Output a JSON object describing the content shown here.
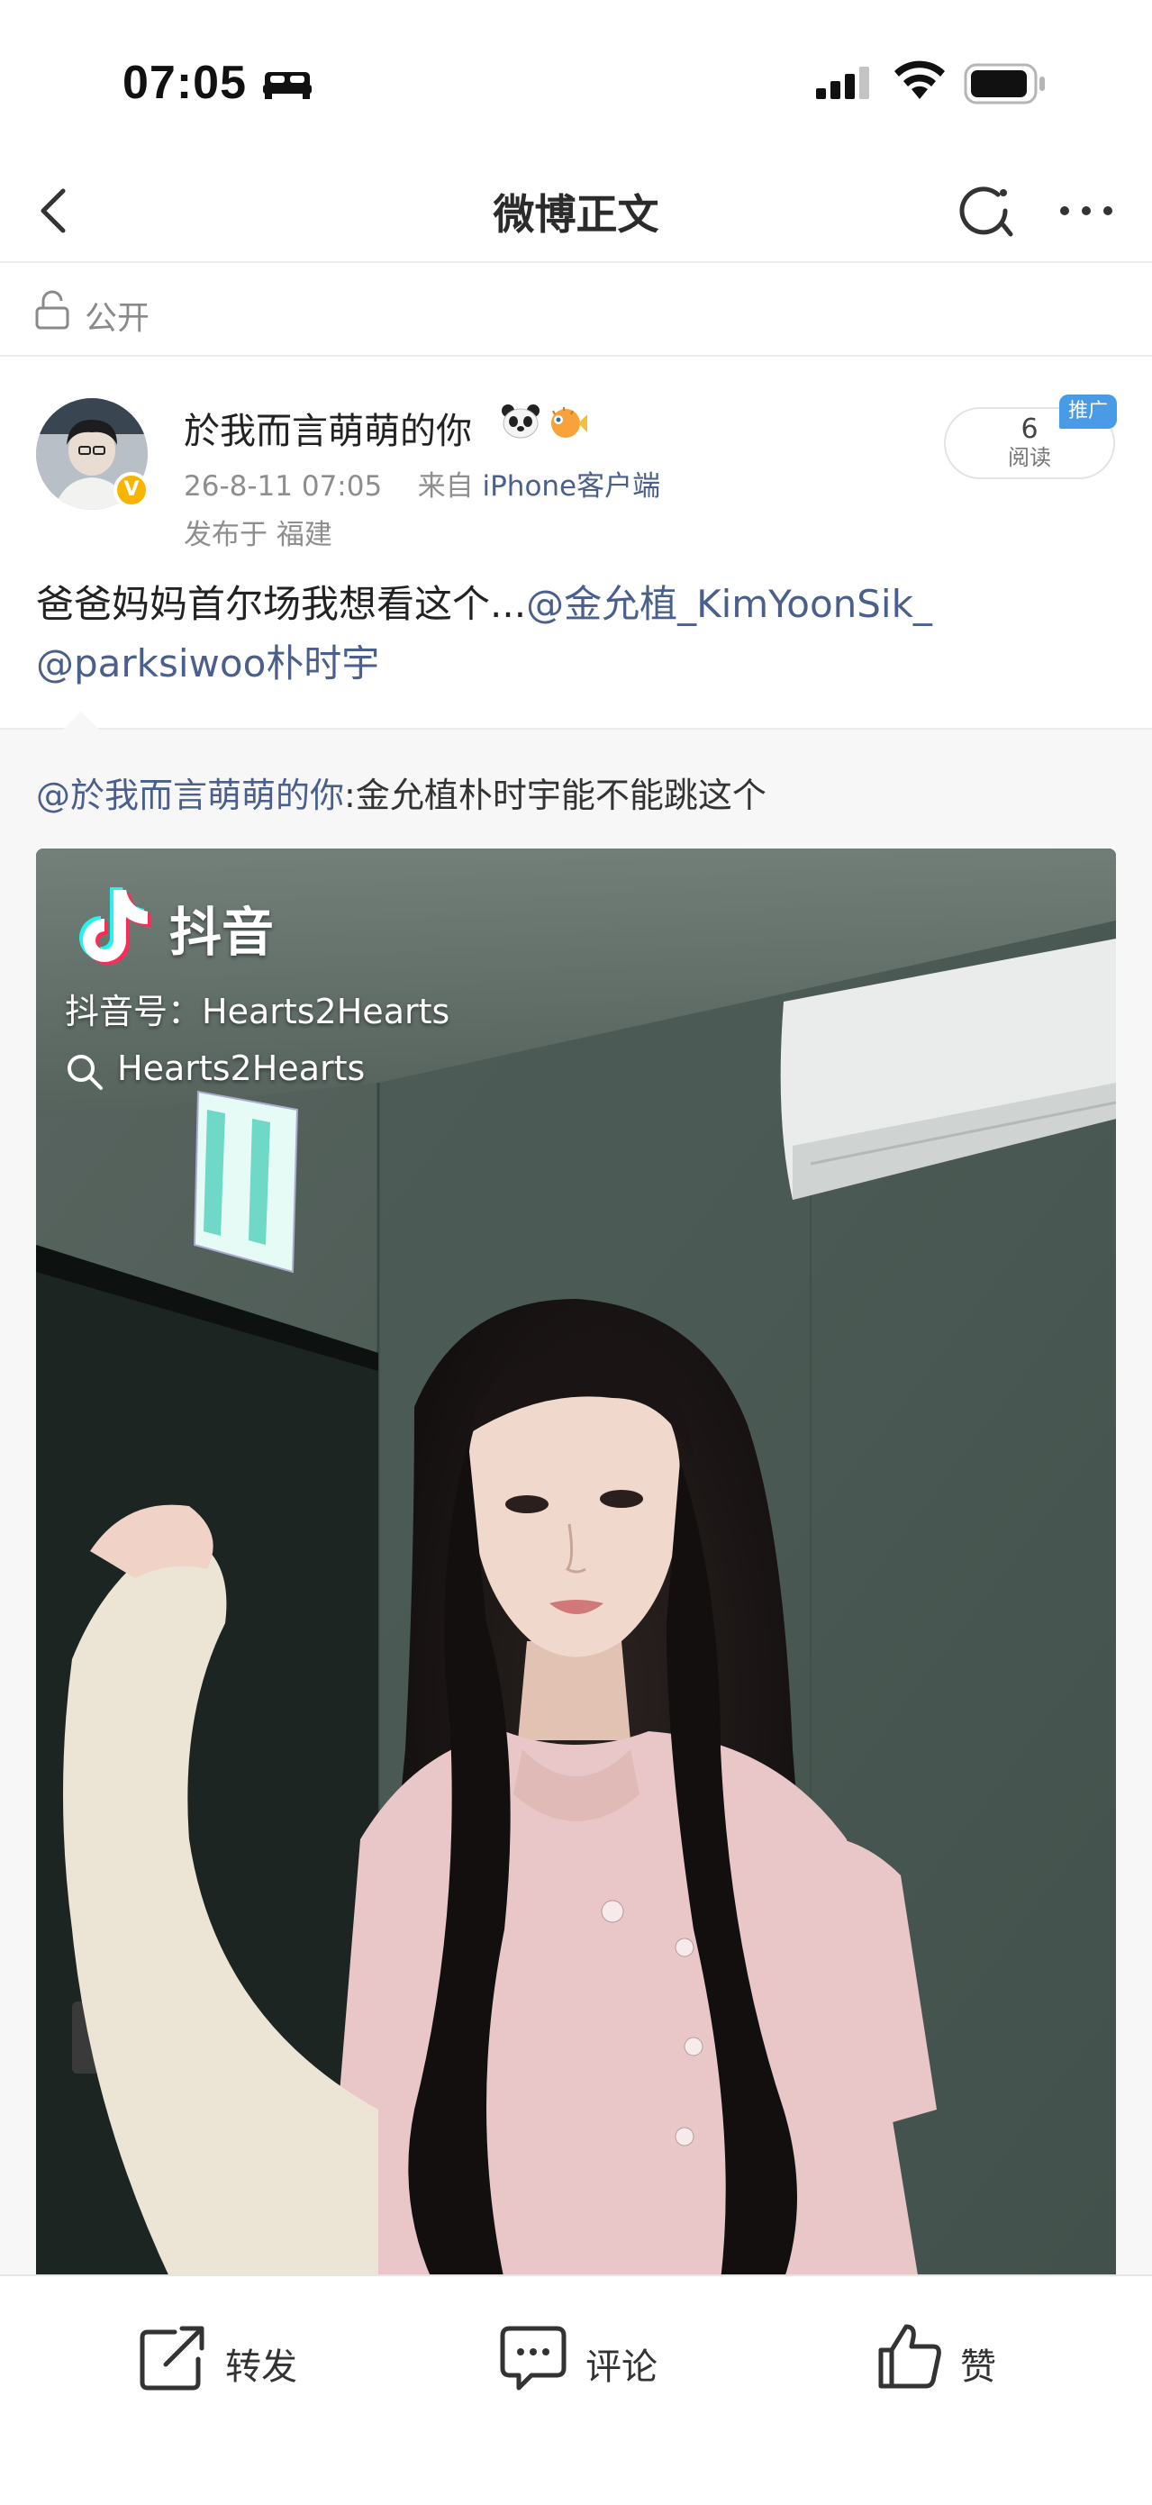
{
  "status_bar": {
    "time": "07:05"
  },
  "nav": {
    "title": "微博正文"
  },
  "visibility": {
    "label": "公开"
  },
  "post": {
    "username": "於我而言萌萌的你",
    "timestamp": "26-8-11 07:05",
    "source_prefix": "来自",
    "source": "iPhone客户端",
    "location": "发布于 福建",
    "reads_count": "6",
    "reads_label": "阅读",
    "promo_tag": "推广",
    "text": "爸爸妈妈首尔场我想看这个...",
    "mention_1": "@金允植_KimYoonSik_",
    "mention_2": "@parksiwoo朴时宇"
  },
  "repost": {
    "mention": "@於我而言萌萌的你",
    "text": ":金允植朴时宇能不能跳这个"
  },
  "video": {
    "brand": "抖音",
    "account_line": "抖音号：Hearts2Hearts",
    "search_text": "Hearts2Hearts"
  },
  "actions": {
    "repost": "转发",
    "comment": "评论",
    "like": "赞"
  },
  "colors": {
    "link": "#4a5f8c",
    "promo": "#4a9be6",
    "verified": "#f7b500"
  }
}
